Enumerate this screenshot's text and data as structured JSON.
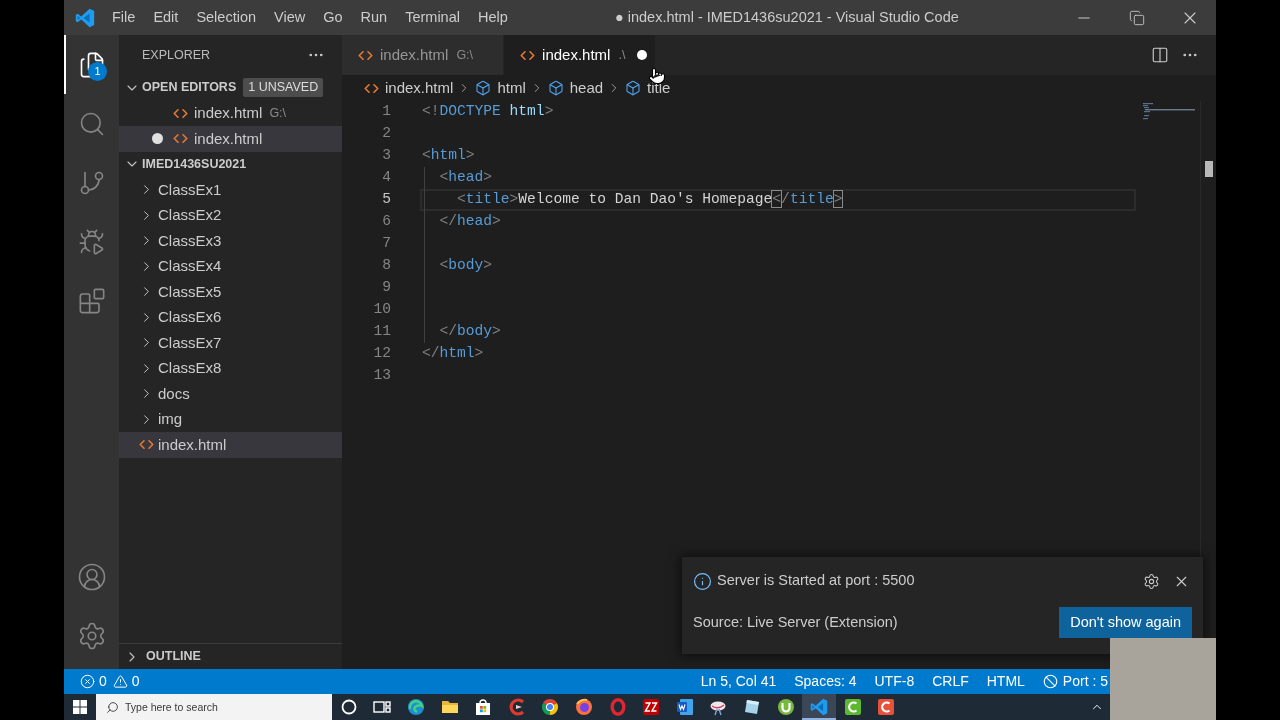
{
  "window": {
    "title": "● index.html - IMED1436su2021 - Visual Studio Code"
  },
  "menu": [
    "File",
    "Edit",
    "Selection",
    "View",
    "Go",
    "Run",
    "Terminal",
    "Help"
  ],
  "activity_bar": {
    "top": [
      {
        "kind": "explorer",
        "selected": true,
        "badge": "1"
      },
      {
        "kind": "search",
        "selected": false
      },
      {
        "kind": "source_control",
        "selected": false
      },
      {
        "kind": "run_debug",
        "selected": false
      },
      {
        "kind": "extensions",
        "selected": false
      }
    ],
    "bottom": [
      {
        "kind": "accounts"
      },
      {
        "kind": "manage"
      }
    ]
  },
  "sidebar": {
    "title": "EXPLORER",
    "open_editors": {
      "label": "OPEN EDITORS",
      "expanded": true,
      "badge": "1 UNSAVED",
      "items": [
        {
          "name": "index.html",
          "description": "G:\\",
          "dirty": false,
          "selected": false
        },
        {
          "name": "index.html",
          "dirty": true,
          "selected": true
        }
      ]
    },
    "folder": {
      "label": "IMED1436SU2021",
      "expanded": true,
      "children": [
        {
          "kind": "folder",
          "name": "ClassEx1",
          "expanded": false,
          "selected": false
        },
        {
          "kind": "folder",
          "name": "ClassEx2",
          "expanded": false,
          "selected": false
        },
        {
          "kind": "folder",
          "name": "ClassEx3",
          "expanded": false,
          "selected": false
        },
        {
          "kind": "folder",
          "name": "ClassEx4",
          "expanded": false,
          "selected": false
        },
        {
          "kind": "folder",
          "name": "ClassEx5",
          "expanded": false,
          "selected": false
        },
        {
          "kind": "folder",
          "name": "ClassEx6",
          "expanded": false,
          "selected": false
        },
        {
          "kind": "folder",
          "name": "ClassEx7",
          "expanded": false,
          "selected": false
        },
        {
          "kind": "folder",
          "name": "ClassEx8",
          "expanded": false,
          "selected": false
        },
        {
          "kind": "folder",
          "name": "docs",
          "expanded": false,
          "selected": false
        },
        {
          "kind": "folder",
          "name": "img",
          "expanded": false,
          "selected": false
        },
        {
          "kind": "file",
          "name": "index.html",
          "selected": true
        }
      ]
    },
    "outline": {
      "label": "OUTLINE",
      "expanded": false
    }
  },
  "tabs": [
    {
      "label": "index.html",
      "description": "G:\\",
      "selected": false,
      "dirty": false
    },
    {
      "label": "index.html",
      "description": ".\\",
      "selected": true,
      "dirty": true
    }
  ],
  "breadcrumbs": [
    {
      "kind": "file",
      "label": "index.html"
    },
    {
      "kind": "element",
      "label": "html"
    },
    {
      "kind": "element",
      "label": "head"
    },
    {
      "kind": "element",
      "label": "title"
    }
  ],
  "editor": {
    "lines": [
      {
        "number": "1",
        "current": false,
        "tokens": [
          {
            "kind": "punct",
            "text": "<!"
          },
          {
            "kind": "tag",
            "text": "DOCTYPE"
          },
          {
            "kind": "attr",
            "text": " html"
          },
          {
            "kind": "punct",
            "text": ">"
          }
        ]
      },
      {
        "number": "2",
        "current": false
      },
      {
        "number": "3",
        "current": false,
        "tokens": [
          {
            "kind": "punct",
            "text": "<"
          },
          {
            "kind": "tag",
            "text": "html"
          },
          {
            "kind": "punct",
            "text": ">"
          }
        ]
      },
      {
        "number": "4",
        "current": false,
        "tokens": [
          {
            "kind": "punct",
            "text": "  <"
          },
          {
            "kind": "tag",
            "text": "head"
          },
          {
            "kind": "punct",
            "text": ">"
          }
        ]
      },
      {
        "number": "5",
        "current": true,
        "tokens": [
          {
            "kind": "punct",
            "text": "    <"
          },
          {
            "kind": "tag",
            "text": "title"
          },
          {
            "kind": "punct",
            "text": ">"
          },
          {
            "kind": "text",
            "text": "Welcome to Dan Dao's Homepage"
          },
          {
            "kind": "match",
            "text": "<"
          },
          {
            "kind": "punct",
            "text": "/"
          },
          {
            "kind": "tag",
            "text": "title"
          },
          {
            "kind": "match",
            "text": ">"
          }
        ]
      },
      {
        "number": "6",
        "current": false,
        "tokens": [
          {
            "kind": "punct",
            "text": "  </"
          },
          {
            "kind": "tag",
            "text": "head"
          },
          {
            "kind": "punct",
            "text": ">"
          }
        ]
      },
      {
        "number": "7",
        "current": false
      },
      {
        "number": "8",
        "current": false,
        "tokens": [
          {
            "kind": "punct",
            "text": "  <"
          },
          {
            "kind": "tag",
            "text": "body"
          },
          {
            "kind": "punct",
            "text": ">"
          }
        ]
      },
      {
        "number": "9",
        "current": false
      },
      {
        "number": "10",
        "current": false
      },
      {
        "number": "11",
        "current": false,
        "tokens": [
          {
            "kind": "punct",
            "text": "  </"
          },
          {
            "kind": "tag",
            "text": "body"
          },
          {
            "kind": "punct",
            "text": ">"
          }
        ]
      },
      {
        "number": "12",
        "current": false,
        "tokens": [
          {
            "kind": "punct",
            "text": "</"
          },
          {
            "kind": "tag",
            "text": "html"
          },
          {
            "kind": "punct",
            "text": ">"
          }
        ]
      },
      {
        "number": "13",
        "current": false
      }
    ]
  },
  "notification": {
    "message": "Server is Started at port : 5500",
    "source": "Source: Live Server (Extension)",
    "button": "Don't show again"
  },
  "status_bar": {
    "left": [
      {
        "kind": "errors",
        "count": "0"
      },
      {
        "kind": "warnings",
        "count": "0"
      }
    ],
    "right": [
      {
        "kind": "text",
        "label": "Ln 5, Col 41"
      },
      {
        "kind": "text",
        "label": "Spaces: 4"
      },
      {
        "kind": "text",
        "label": "UTF-8"
      },
      {
        "kind": "text",
        "label": "CRLF"
      },
      {
        "kind": "text",
        "label": "HTML"
      },
      {
        "kind": "port",
        "label": "Port : 5"
      }
    ]
  },
  "taskbar": {
    "search": {
      "placeholder": "Type here to search"
    },
    "apps": [
      {
        "kind": "ring",
        "active": false
      },
      {
        "kind": "taskview",
        "active": false
      },
      {
        "kind": "swirl",
        "active": false
      },
      {
        "kind": "folder",
        "active": false
      },
      {
        "kind": "bag",
        "active": false
      },
      {
        "kind": "crescent",
        "active": false
      },
      {
        "kind": "wheel",
        "active": false
      },
      {
        "kind": "orb",
        "active": false
      },
      {
        "kind": "hoop",
        "active": false
      },
      {
        "kind": "zigzag",
        "active": false
      },
      {
        "kind": "document",
        "active": false
      },
      {
        "kind": "dish",
        "active": false
      },
      {
        "kind": "slab",
        "active": false
      },
      {
        "kind": "disc",
        "active": false
      },
      {
        "kind": "ribbon",
        "active": true
      },
      {
        "kind": "arc_green",
        "active": false
      },
      {
        "kind": "arc_orange",
        "active": false
      }
    ]
  }
}
